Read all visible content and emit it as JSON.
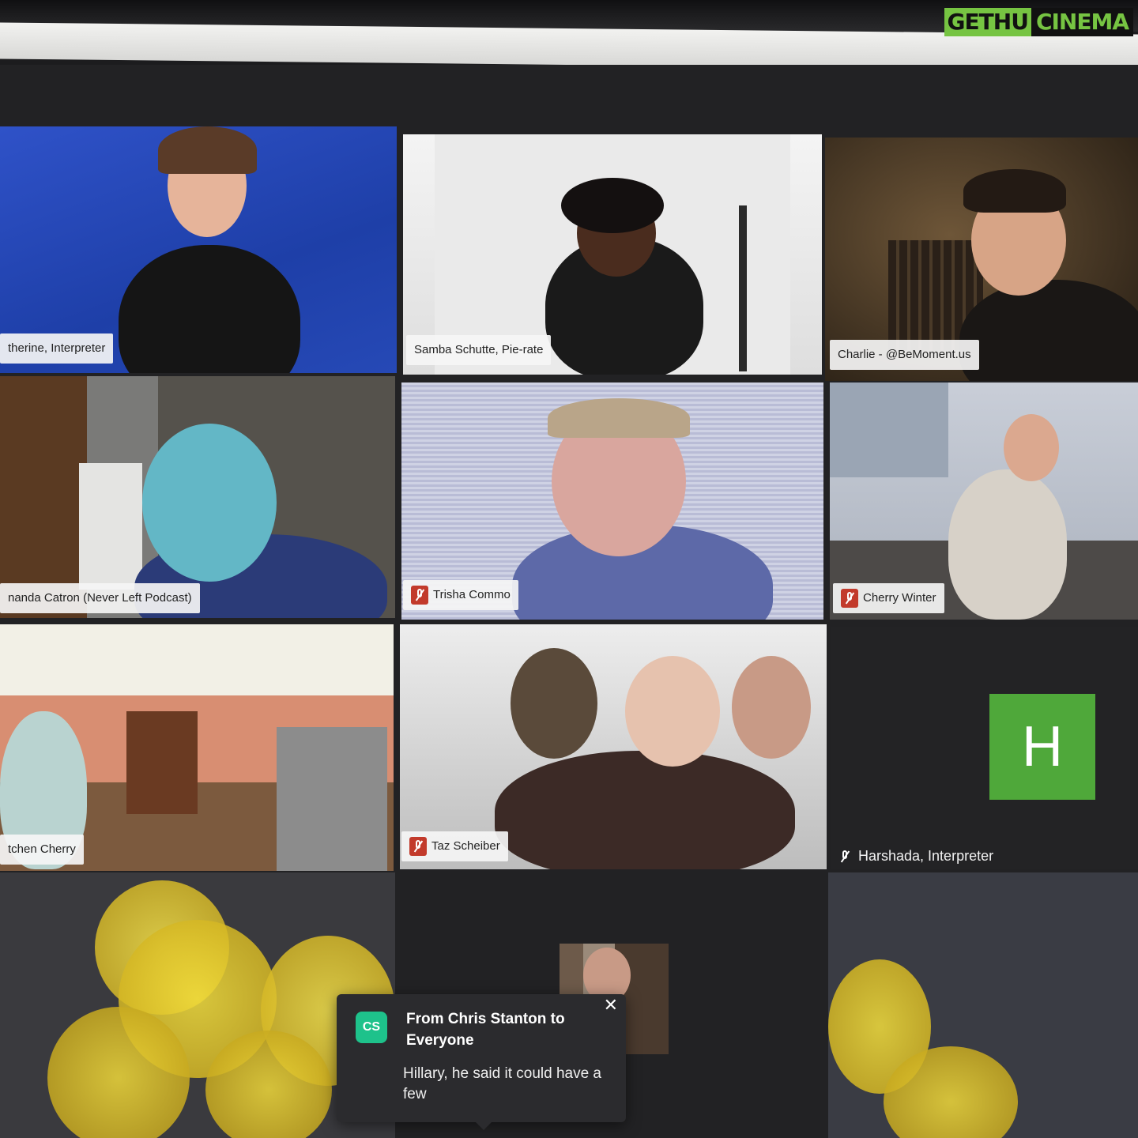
{
  "watermark": {
    "part1": "GETHU",
    "part2": "CINEMA"
  },
  "colors": {
    "active_speaker_border": "#c7e23c",
    "avatar_green": "#4fa83a",
    "chat_avatar": "#1ec28b",
    "muted_red": "#c23a2b"
  },
  "participants": [
    {
      "name": "therine, Interpreter",
      "muted": false
    },
    {
      "name": "Samba Schutte, Pie-rate",
      "muted": false
    },
    {
      "name": "Charlie - @BeMoment.us",
      "muted": false,
      "active_speaker": true
    },
    {
      "name": "nanda Catron (Never Left Podcast)",
      "muted": false
    },
    {
      "name": "Trisha Commo",
      "muted": true
    },
    {
      "name": "Cherry Winter",
      "muted": true
    },
    {
      "name": "tchen Cherry",
      "muted": false
    },
    {
      "name": "Taz Scheiber",
      "muted": true
    },
    {
      "name": "Harshada, Interpreter",
      "muted": true,
      "avatar_letter": "H"
    }
  ],
  "icons": {
    "muted": "microphone-muted-icon",
    "close": "close-icon"
  },
  "chat": {
    "avatar_initials": "CS",
    "title": "From Chris Stanton to Everyone",
    "message": "Hillary, he said it could have a few",
    "close_symbol": "✕"
  }
}
